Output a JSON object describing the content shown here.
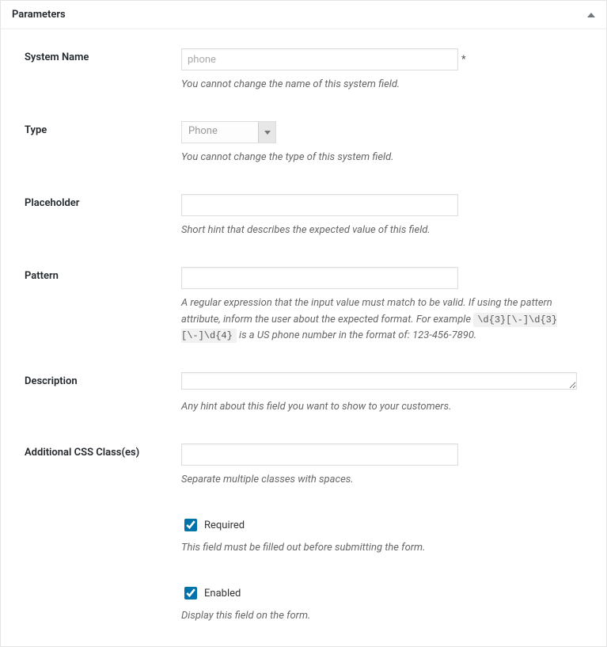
{
  "panel": {
    "title": "Parameters"
  },
  "systemName": {
    "label": "System Name",
    "value": "phone",
    "required_mark": "*",
    "help": "You cannot change the name of this system field."
  },
  "type": {
    "label": "Type",
    "value": "Phone",
    "help": "You cannot change the type of this system field."
  },
  "placeholder": {
    "label": "Placeholder",
    "value": "",
    "help": "Short hint that describes the expected value of this field."
  },
  "pattern": {
    "label": "Pattern",
    "value": "",
    "help_pre": "A regular expression that the input value must match to be valid. If using the pattern attribute, inform the user about the expected format. For example ",
    "code": "\\d{3}[\\-]\\d{3}[\\-]\\d{4}",
    "help_post": " is a US phone number in the format of: 123-456-7890."
  },
  "description": {
    "label": "Description",
    "value": "",
    "help": "Any hint about this field you want to show to your customers."
  },
  "cssClasses": {
    "label": "Additional CSS Class(es)",
    "value": "",
    "help": "Separate multiple classes with spaces."
  },
  "required": {
    "label": "Required",
    "checked": true,
    "help": "This field must be filled out before submitting the form."
  },
  "enabled": {
    "label": "Enabled",
    "checked": true,
    "help": "Display this field on the form."
  }
}
